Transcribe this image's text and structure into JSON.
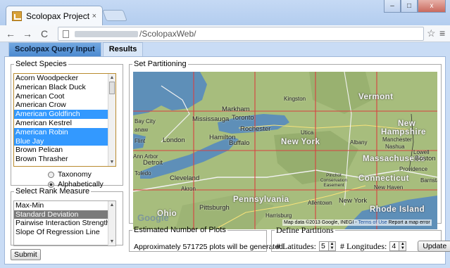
{
  "browser": {
    "tab_title": "Scolopax Project",
    "tab_close": "×",
    "address_path": "/ScolopaxWeb/",
    "window_minimize": "–",
    "window_maximize": "□",
    "window_close": "x"
  },
  "app_tabs": [
    "Scolopax Query Input",
    "Results"
  ],
  "species": {
    "legend": "Select Species",
    "items": [
      "Acorn Woodpecker",
      "American Black Duck",
      "American Coot",
      "American Crow",
      "American Goldfinch",
      "American Kestrel",
      "American Robin",
      "Blue Jay",
      "Brown Pelican",
      "Brown Thrasher"
    ],
    "selected": [
      "American Goldfinch",
      "American Robin",
      "Blue Jay"
    ],
    "sort_options": [
      "Taxonomy",
      "Alphabetically"
    ],
    "sort_selected": "Alphabetically"
  },
  "rank": {
    "legend": "Select Rank Measure",
    "items": [
      "Max-Min",
      "Standard Deviation",
      "Pairwise Interaction Strength",
      "Slope Of Regression Line"
    ],
    "selected": "Standard Deviation"
  },
  "submit_label": "Submit",
  "map": {
    "legend": "Set Partitioning",
    "rows": 4,
    "cols": 5,
    "grid_color": "#d94040",
    "labels": [
      "Kingston",
      "Vermont",
      "Markham",
      "Mississauga",
      "Toronto",
      "Bay City",
      "New",
      "Hampshire",
      "Rochester",
      "Utica",
      "Hamilton",
      "London",
      "Buffalo",
      "New York",
      "Albany",
      "Manchester",
      "Nashua",
      "Lowell",
      "Massachusetts",
      "Boston",
      "Ann Arbor",
      "Detroit",
      "Toledo",
      "Providence",
      "Cleveland",
      "Pinchot Conservation Easement",
      "Connecticut",
      "Barnstab",
      "New Haven",
      "Akron",
      "Pennsylvania",
      "Allentown",
      "New York",
      "Pittsburgh",
      "Harrisburg",
      "Ohio",
      "Rhode Island",
      "Flint",
      "anaw"
    ],
    "google_logo": "Google",
    "attribution": "Map data ©2013 Google, INEGI - ",
    "terms_link": "Terms of Use",
    "report_link": "Report a map error"
  },
  "plots": {
    "legend": "Estimated Number of Plots",
    "text": "Approximately 571725 plots will be generated"
  },
  "partitions": {
    "legend": "Define Partitions",
    "latitudes_label": "# Latitudes:",
    "latitudes_value": "5",
    "longitudes_label": "# Longitudes:",
    "longitudes_value": "4",
    "update_label": "Update"
  }
}
